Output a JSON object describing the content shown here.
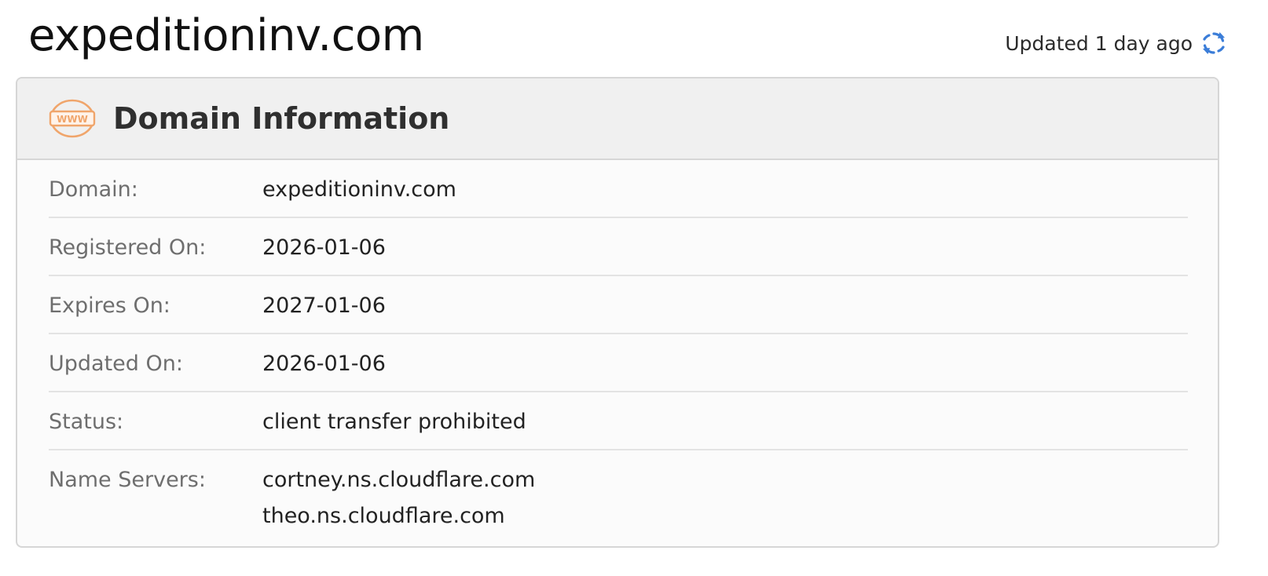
{
  "header": {
    "title": "expeditioninv.com",
    "updated_text": "Updated 1 day ago",
    "refresh_icon": "refresh-icon",
    "accent_color": "#3b7dd8"
  },
  "card": {
    "title": "Domain Information",
    "icon": "www-icon",
    "icon_color": "#f0a56b",
    "rows": [
      {
        "label": "Domain:",
        "value": "expeditioninv.com"
      },
      {
        "label": "Registered On:",
        "value": "2026-01-06"
      },
      {
        "label": "Expires On:",
        "value": "2027-01-06"
      },
      {
        "label": "Updated On:",
        "value": "2026-01-06"
      },
      {
        "label": "Status:",
        "value": "client transfer prohibited"
      },
      {
        "label": "Name Servers:",
        "values": [
          "cortney.ns.cloudflare.com",
          "theo.ns.cloudflare.com"
        ]
      }
    ]
  }
}
